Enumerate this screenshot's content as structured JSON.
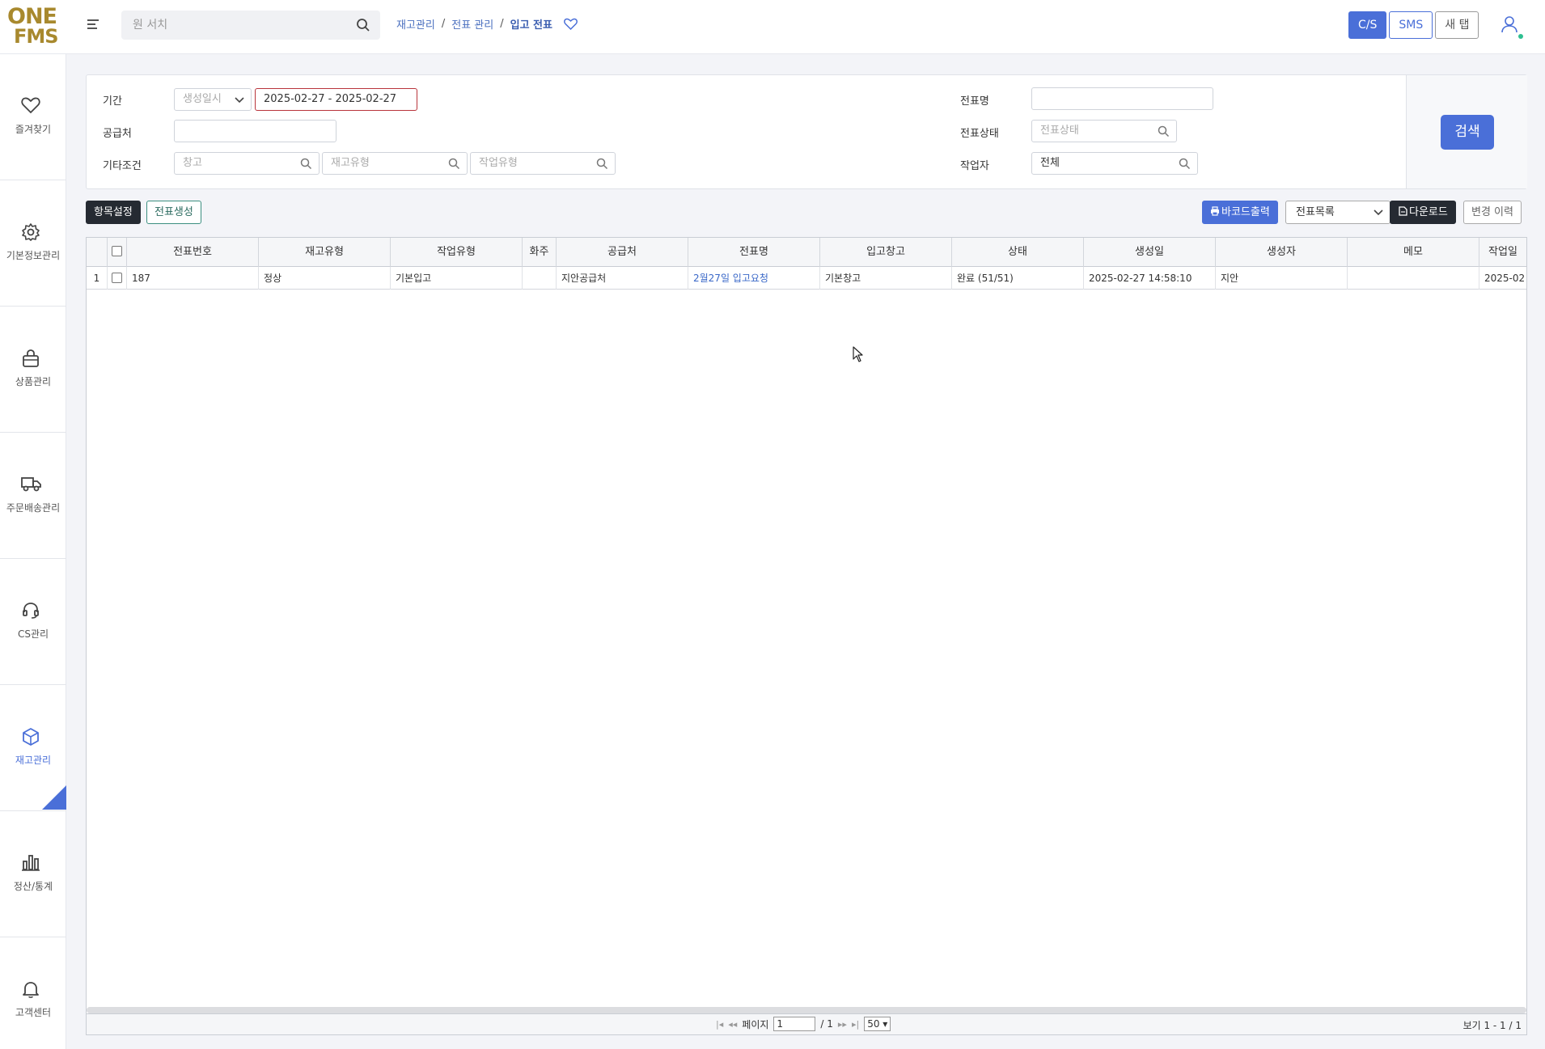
{
  "logo": {
    "line1": "ONE",
    "line2": "FMS"
  },
  "menu_search": {
    "placeholder": "원 서치"
  },
  "breadcrumb": {
    "level1": "재고관리",
    "level2": "전표 관리",
    "current": "입고 전표",
    "sep": "/"
  },
  "top_buttons": {
    "cs": "C/S",
    "sms": "SMS",
    "new_tab": "새 탭"
  },
  "sidebar": {
    "items": [
      {
        "label": "즐겨찾기",
        "icon": "heart-icon"
      },
      {
        "label": "기본정보관리",
        "icon": "gear-icon"
      },
      {
        "label": "상품관리",
        "icon": "bag-icon"
      },
      {
        "label": "주문배송관리",
        "icon": "truck-icon"
      },
      {
        "label": "CS관리",
        "icon": "headset-icon"
      },
      {
        "label": "재고관리",
        "icon": "box-icon"
      },
      {
        "label": "정산/통계",
        "icon": "bar-chart-icon"
      },
      {
        "label": "고객센터",
        "icon": "bell-icon"
      }
    ],
    "active_index": 5,
    "active_color": "#4a6fd8"
  },
  "filter": {
    "period_label": "기간",
    "period_type": "생성일시",
    "period_range": "2025-02-27 - 2025-02-27",
    "supplier_label": "공급처",
    "supplier_value": "",
    "etc_label": "기타조건",
    "warehouse_placeholder": "창고",
    "stock_type_placeholder": "재고유형",
    "work_type_placeholder": "작업유형",
    "slip_name_label": "전표명",
    "slip_name_value": "",
    "slip_status_label": "전표상태",
    "slip_status_placeholder": "전표상태",
    "worker_label": "작업자",
    "worker_value": "전체",
    "search_button": "검색"
  },
  "toolbar": {
    "column_settings": "항목설정",
    "create_slip": "전표생성",
    "barcode_print": "바코드출력",
    "list_select": "전표목록",
    "download": "다운로드",
    "change_history": "변경 이력"
  },
  "table": {
    "columns": [
      "전표번호",
      "재고유형",
      "작업유형",
      "화주",
      "공급처",
      "전표명",
      "입고창고",
      "상태",
      "생성일",
      "생성자",
      "메모",
      "작업일"
    ],
    "rows": [
      {
        "no": "1",
        "slip_no": "187",
        "stock_type": "정상",
        "work_type": "기본입고",
        "owner": "",
        "supplier": "지안공급처",
        "slip_name": "2월27일 입고요청",
        "warehouse": "기본창고",
        "status": "완료 (51/51)",
        "created": "2025-02-27 14:58:10",
        "creator": "지안",
        "memo": "",
        "work_date": "2025-02"
      }
    ]
  },
  "pager": {
    "page_label": "페이지",
    "page": "1",
    "total": "/ 1",
    "page_size": "50",
    "view_info": "보기 1 - 1 / 1"
  },
  "colors": {
    "brand": "#a8892e",
    "accent": "#4a6fd8",
    "date_border": "#b8343b"
  }
}
